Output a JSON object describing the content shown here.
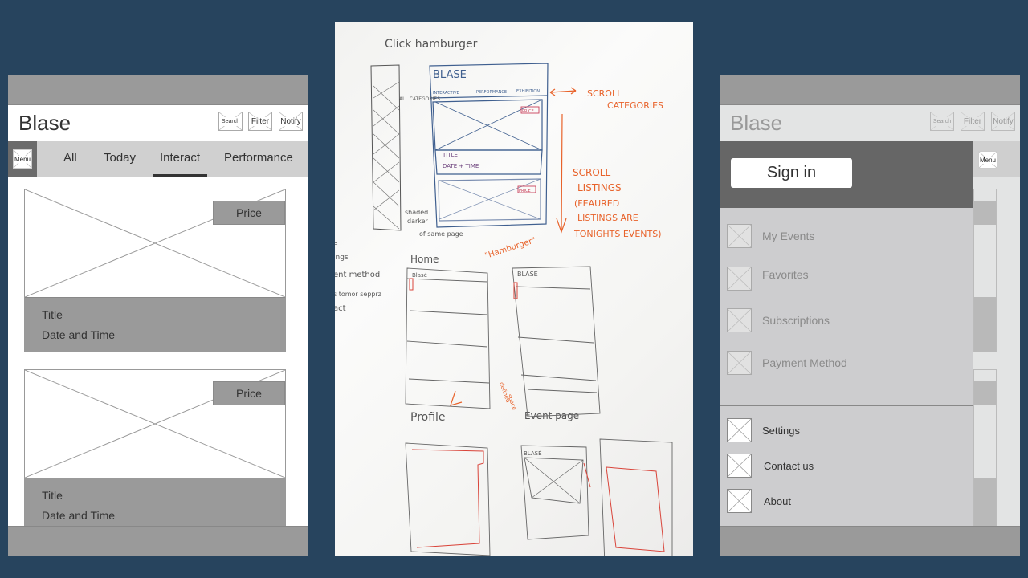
{
  "left_mockup": {
    "app_title": "Blase",
    "header_buttons": {
      "search": "Search",
      "filter": "Filter",
      "notify": "Notify"
    },
    "menu_button": "Menu",
    "tabs": [
      {
        "label": "All"
      },
      {
        "label": "Today"
      },
      {
        "label": "Interact",
        "active": true
      },
      {
        "label": "Performance"
      }
    ],
    "cards": [
      {
        "price": "Price",
        "title": "Title",
        "datetime": "Date and Time"
      },
      {
        "price": "Price",
        "title": "Title",
        "datetime": "Date and Time"
      }
    ]
  },
  "whiteboard": {
    "notes": {
      "click_hamburger": "Click hamburger",
      "sketch_logo": "BLASE",
      "sketch_tabs": [
        "INTERACTIVE",
        "PERFORMANCE",
        "EXHIBITION"
      ],
      "all_categories": "ALL CATEGORIES",
      "scroll_categories": [
        "SCROLL",
        "CATEGORIES"
      ],
      "sketch_title": "TITLE",
      "sketch_datetime": "DATE + TIME",
      "sketch_price": "PRICE",
      "scroll_listings": [
        "SCROLL",
        "LISTINGS",
        "(FEAURED",
        "LISTINGS ARE",
        "TONIGHTS EVENTS)"
      ],
      "shaded_darker": [
        "shaded",
        "darker"
      ],
      "of_same_page": "of same page",
      "left_notes": [
        "e",
        "ings",
        "ent method",
        "s tomor sepprz",
        "act"
      ],
      "home": "Home",
      "hamburger": "\"Hamburger\"",
      "home_logo": "Blasé",
      "hamburger_logo": "BLASÉ",
      "defined_space": [
        "defined",
        "space"
      ],
      "profile": "Profile",
      "event_page": "Event page",
      "event_logo": "BLASÉ"
    }
  },
  "right_mockup": {
    "app_title": "Blase",
    "header_buttons": {
      "search": "Search",
      "filter": "Filter",
      "notify": "Notify"
    },
    "menu_button": "Menu",
    "sign_in": "Sign in",
    "primary_items": [
      {
        "label": "My Events"
      },
      {
        "label": "Favorites"
      },
      {
        "label": "Subscriptions"
      },
      {
        "label": "Payment Method"
      }
    ],
    "secondary_items": [
      {
        "label": "Settings"
      },
      {
        "label": "Contact us"
      },
      {
        "label": "About"
      }
    ]
  },
  "colors": {
    "background": "#27445e",
    "bar_gray": "#9a9a9a",
    "drawer_gray": "#cdcdcf",
    "drawer_header": "#666666",
    "sketch_orange": "#e8622a",
    "sketch_blue": "#3f5f8f"
  }
}
